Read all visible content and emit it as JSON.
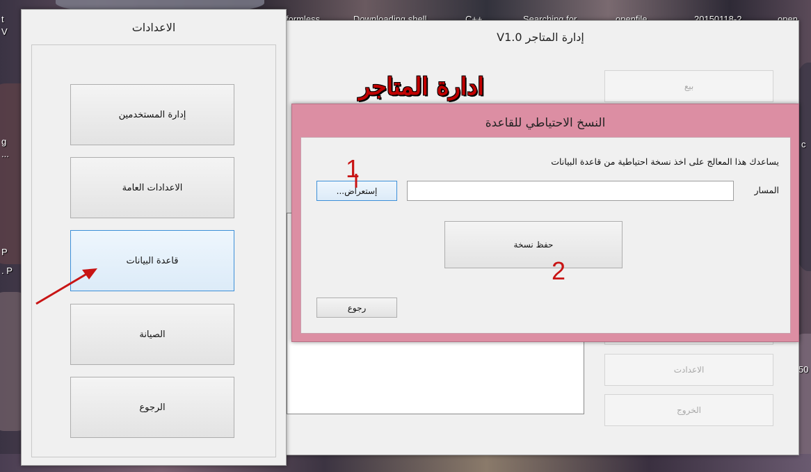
{
  "desktop": {
    "top_labels": [
      "t",
      "formless",
      "Downloading shell",
      "C++",
      "Searching for",
      "openfile",
      "20150118-2",
      "open"
    ],
    "side_labels_left": [
      "V",
      "g",
      "...",
      "P",
      ". P"
    ],
    "side_labels_right": [
      "c",
      "50"
    ]
  },
  "main_window": {
    "title": "إدارة المتاجر V1.0",
    "banner_text": "ادارة المتاجر",
    "buttons": [
      {
        "label": "بيع",
        "enabled": false
      },
      {
        "label": "الاعدادت",
        "enabled": false
      },
      {
        "label": "الخروج",
        "enabled": false
      }
    ]
  },
  "settings_window": {
    "title": "الاعدادات",
    "buttons": [
      {
        "label": "إدارة المستخدمين"
      },
      {
        "label": "الاعدادات العامة"
      },
      {
        "label": "قاعدة البيانات",
        "focused": true
      },
      {
        "label": "الصيانة"
      },
      {
        "label": "الرجوع"
      }
    ]
  },
  "backup_dialog": {
    "title": "النسخ الاحتياطي للقاعدة",
    "description": "يساعدك هذا المعالج على اخذ نسخة احتياطية من قاعدة البيانات",
    "path_label": "المسار",
    "path_value": "",
    "browse_label": "إستعراض...",
    "save_label": "حفظ نسخة",
    "back_label": "رجوع",
    "title_bar_color": "#dc8ea3"
  },
  "annotations": {
    "step1": "1",
    "step2": "2",
    "arrow_color": "#c81414"
  }
}
